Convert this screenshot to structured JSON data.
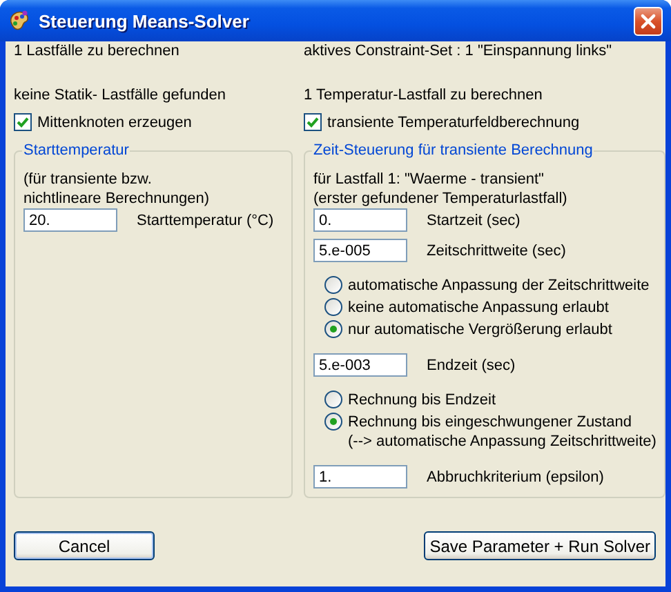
{
  "window": {
    "title": "Steuerung Means-Solver"
  },
  "left_column": {
    "texts": [
      "1 Lastfälle zu berechnen",
      "keine Statik- Lastfälle gefunden"
    ],
    "checkbox": {
      "label": "Mittenknoten erzeugen",
      "checked": true
    },
    "group": {
      "title": "Starttemperatur",
      "items": [
        {
          "kind": "note",
          "text": "(für transiente bzw.\nnichtlineare Berechnungen)"
        },
        {
          "kind": "field",
          "value": "20.",
          "label": "Starttemperatur (°C)"
        }
      ]
    }
  },
  "right_column": {
    "texts": [
      "aktives Constraint-Set : 1 \"Einspannung links\"",
      "1 Temperatur-Lastfall zu berechnen"
    ],
    "checkbox": {
      "label": "transiente Temperaturfeldberechnung",
      "checked": true
    },
    "group": {
      "title": "Zeit-Steuerung für transiente Berechnung",
      "items": [
        {
          "kind": "note",
          "text": "für Lastfall 1: \"Waerme - transient\"\n(erster gefundener Temperaturlastfall)"
        },
        {
          "kind": "field",
          "value": "0.",
          "label": "Startzeit (sec)"
        },
        {
          "kind": "field",
          "value": "5.e-005",
          "label": "Zeitschrittweite (sec)"
        },
        {
          "kind": "radio_group",
          "options": [
            {
              "label": "automatische Anpassung der Zeitschrittweite",
              "selected": false
            },
            {
              "label": "keine automatische Anpassung erlaubt",
              "selected": false
            },
            {
              "label": "nur automatische Vergrößerung erlaubt",
              "selected": true
            }
          ]
        },
        {
          "kind": "field",
          "value": "5.e-003",
          "label": "Endzeit (sec)"
        },
        {
          "kind": "radio_group",
          "options": [
            {
              "label": "Rechnung bis Endzeit",
              "selected": false
            },
            {
              "label": "Rechnung bis eingeschwungener Zustand\n(--> automatische Anpassung Zeitschrittweite)",
              "selected": true
            }
          ]
        },
        {
          "kind": "field",
          "value": "1.",
          "label": "Abbruchkriterium (epsilon)"
        }
      ]
    }
  },
  "buttons": [
    {
      "label": "Cancel",
      "kind": "default"
    },
    {
      "label": "Save Parameter + Run Solver",
      "kind": "normal"
    }
  ]
}
